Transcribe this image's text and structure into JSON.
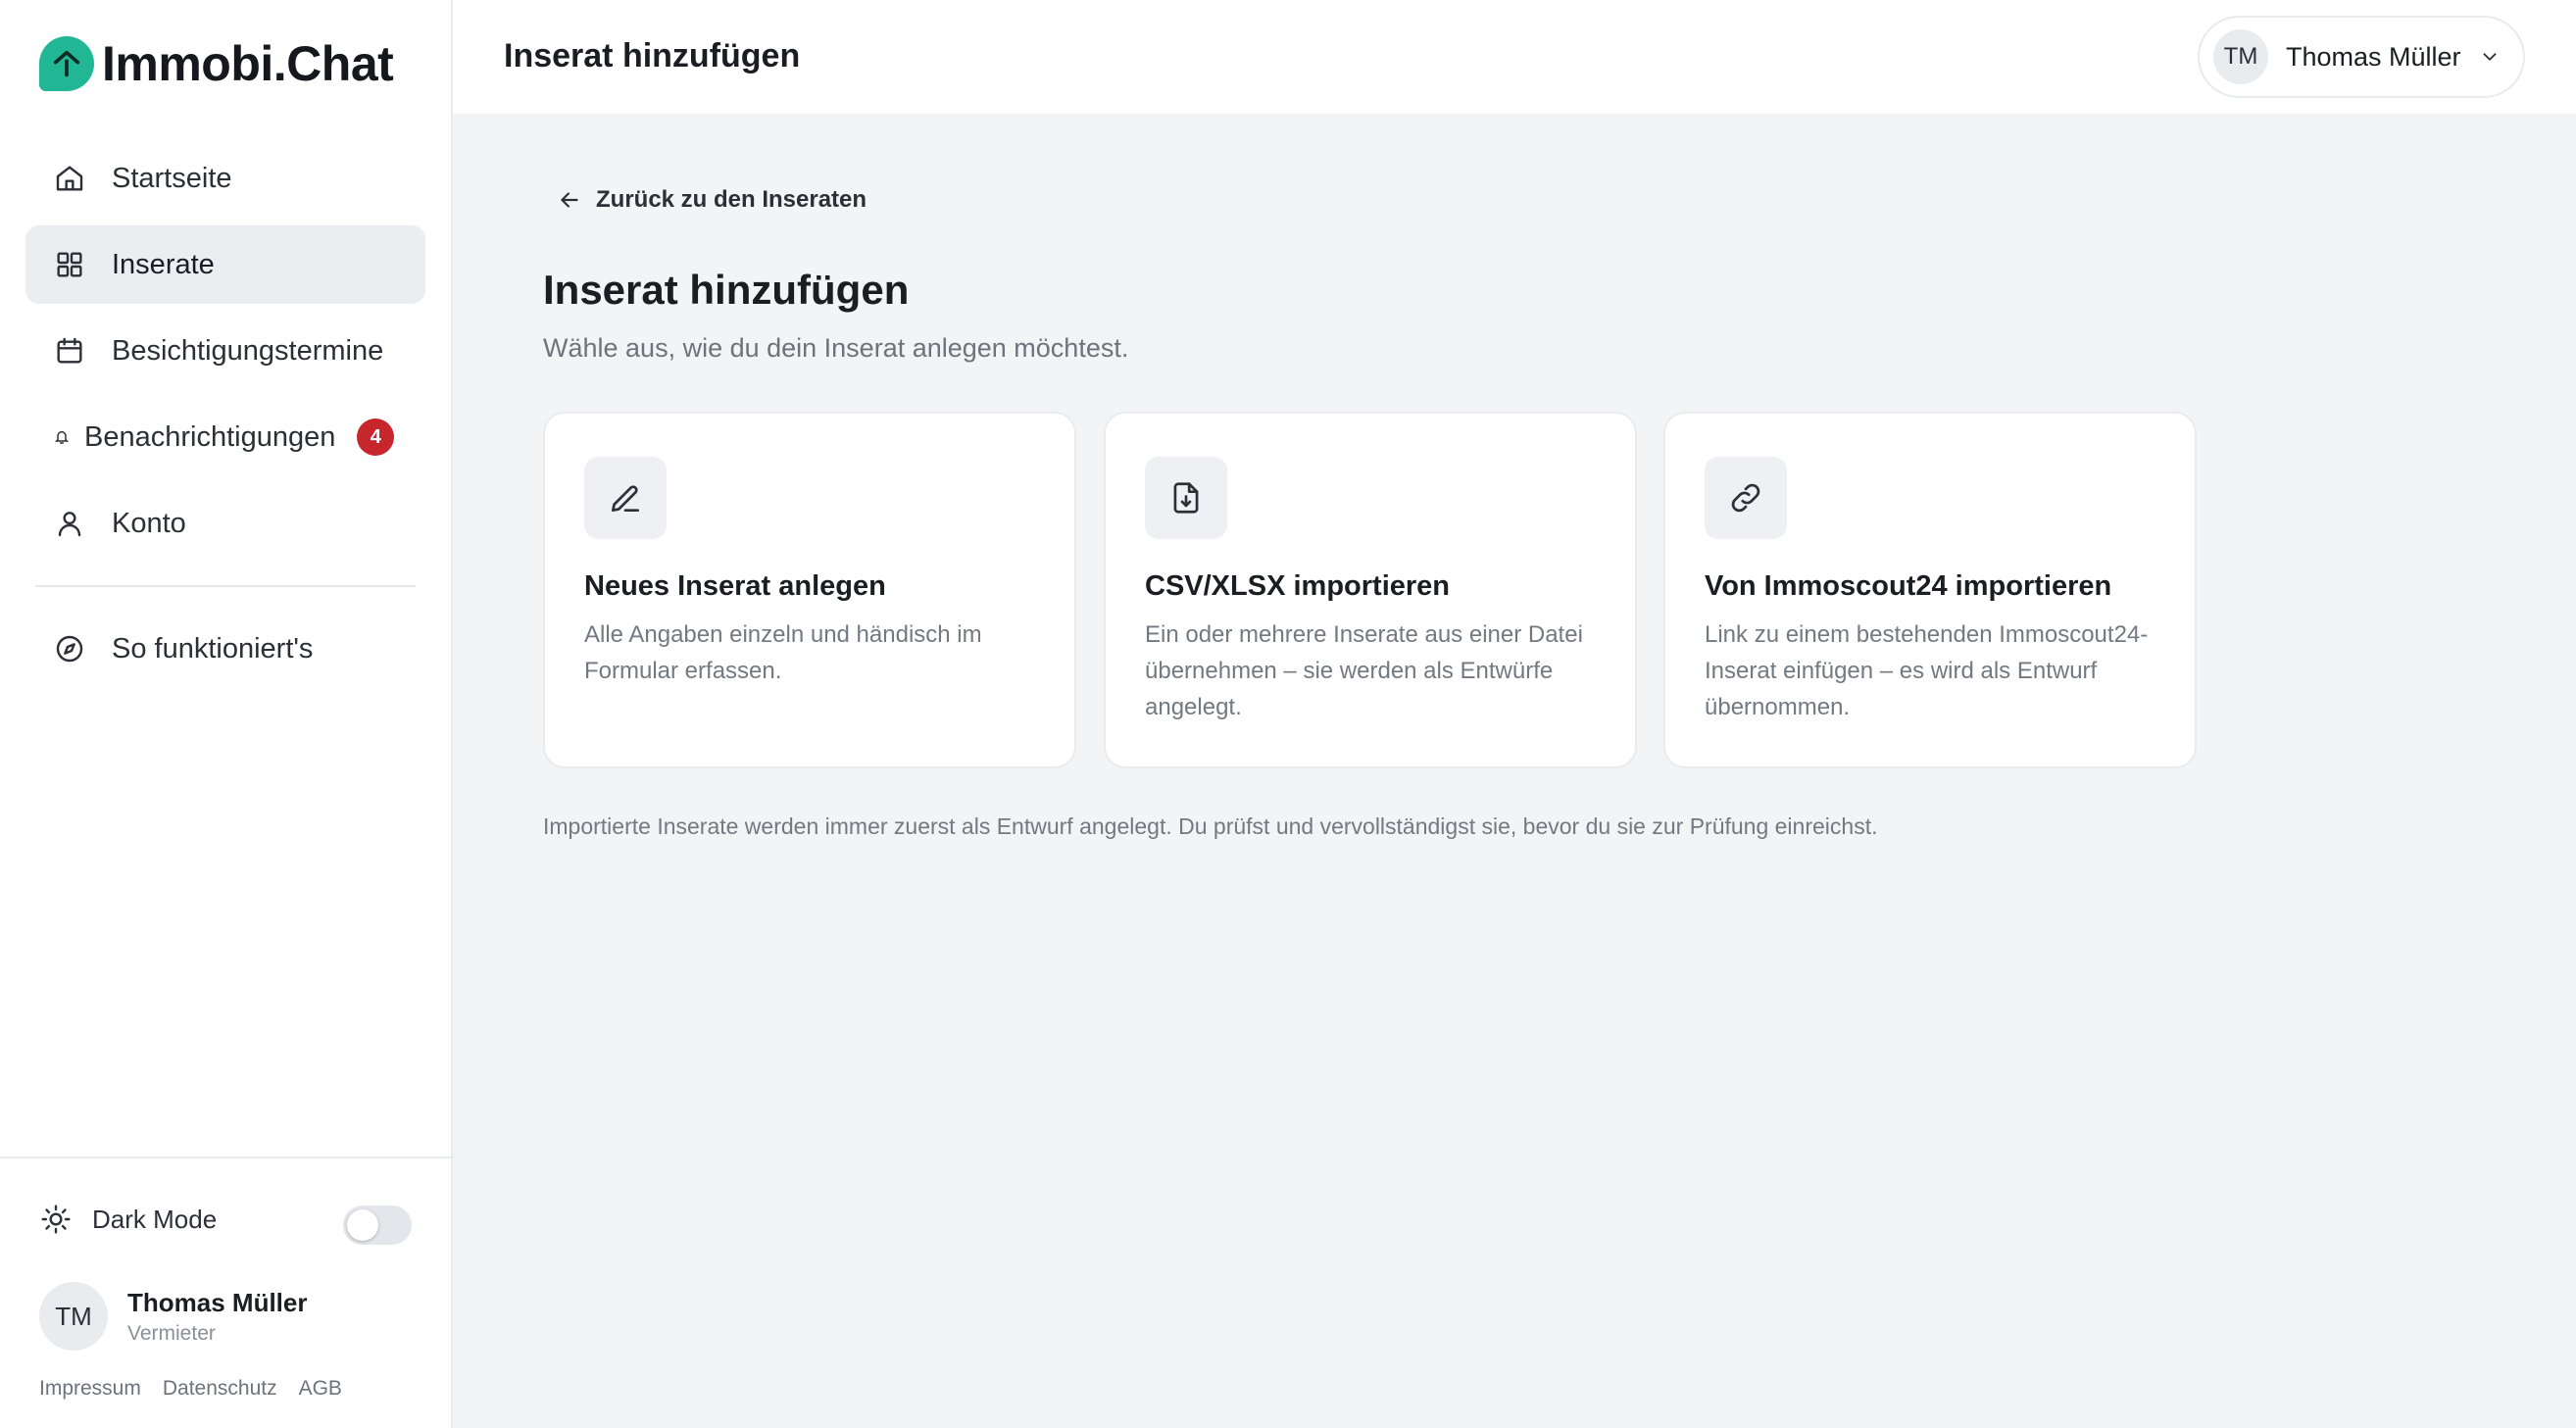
{
  "app": {
    "logo_text": "Immobi.Chat"
  },
  "sidebar": {
    "items": [
      {
        "label": "Startseite",
        "icon": "home-icon"
      },
      {
        "label": "Inserate",
        "icon": "grid-icon",
        "active": true
      },
      {
        "label": "Besichtigungstermine",
        "icon": "calendar-icon"
      },
      {
        "label": "Benachrichtigungen",
        "icon": "bell-icon",
        "badge": "4"
      },
      {
        "label": "Konto",
        "icon": "user-icon"
      }
    ],
    "help": {
      "label": "So funktioniert's",
      "icon": "compass-icon"
    },
    "dark_mode": {
      "label": "Dark Mode",
      "enabled": false
    },
    "user": {
      "initials": "TM",
      "name": "Thomas Müller",
      "role": "Vermieter"
    },
    "footer_links": [
      "Impressum",
      "Datenschutz",
      "AGB"
    ]
  },
  "header": {
    "title": "Inserat hinzufügen",
    "user": {
      "initials": "TM",
      "name": "Thomas Müller"
    }
  },
  "main": {
    "back_label": "Zurück zu den Inseraten",
    "title": "Inserat hinzufügen",
    "subtitle": "Wähle aus, wie du dein Inserat anlegen möchtest.",
    "cards": [
      {
        "title": "Neues Inserat anlegen",
        "description": "Alle Angaben einzeln und händisch im Formular erfassen.",
        "icon": "pencil-icon"
      },
      {
        "title": "CSV/XLSX importieren",
        "description": "Ein oder mehrere Inserate aus einer Datei übernehmen – sie werden als Entwürfe angelegt.",
        "icon": "file-import-icon"
      },
      {
        "title": "Von Immoscout24 importieren",
        "description": "Link zu einem bestehenden Immoscout24-Inserat einfügen – es wird als Entwurf übernommen.",
        "icon": "link-icon"
      }
    ],
    "note": "Importierte Inserate werden immer zuerst als Entwurf angelegt. Du prüfst und vervollständigst sie, bevor du sie zur Prüfung einreichst."
  },
  "colors": {
    "accent": "#22b794",
    "badge": "#c8262d",
    "background": "#f3f4f6"
  }
}
